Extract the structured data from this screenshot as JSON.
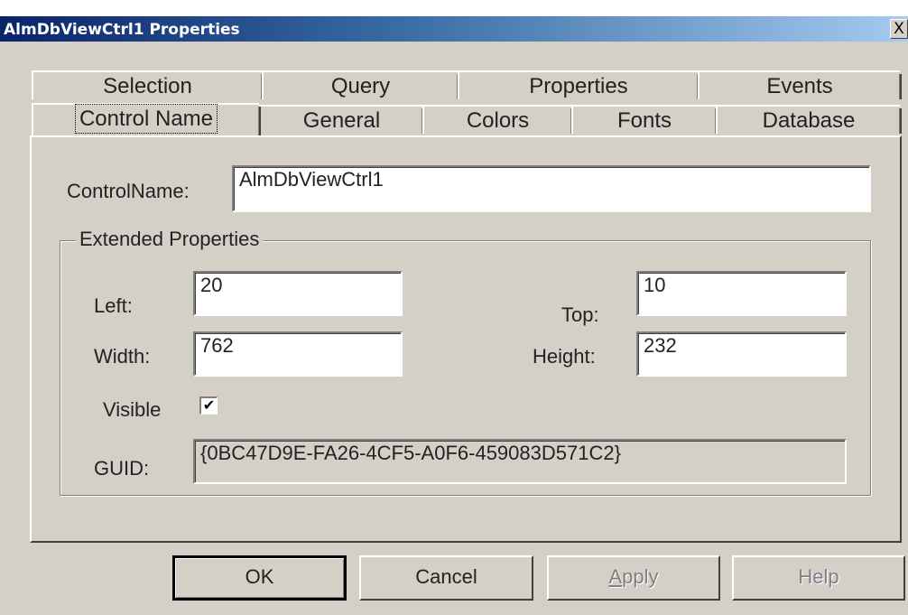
{
  "window": {
    "title": "AlmDbViewCtrl1 Properties",
    "close_label": "X"
  },
  "tabs": {
    "row1": [
      "Selection",
      "Query",
      "Properties",
      "Events"
    ],
    "row2": [
      "Control Name",
      "General",
      "Colors",
      "Fonts",
      "Database"
    ],
    "selected": "Control Name"
  },
  "control_name": {
    "label": "ControlName:",
    "value": "AlmDbViewCtrl1"
  },
  "extended": {
    "title": "Extended Properties",
    "left_label": "Left:",
    "left_value": "20",
    "top_label": "Top:",
    "top_value": "10",
    "width_label": "Width:",
    "width_value": "762",
    "height_label": "Height:",
    "height_value": "232",
    "visible_label": "Visible",
    "visible_checked": true,
    "guid_label": "GUID:",
    "guid_value": "{0BC47D9E-FA26-4CF5-A0F6-459083D571C2}"
  },
  "buttons": {
    "ok": "OK",
    "cancel": "Cancel",
    "apply_first": "A",
    "apply_rest": "pply",
    "help": "Help"
  }
}
